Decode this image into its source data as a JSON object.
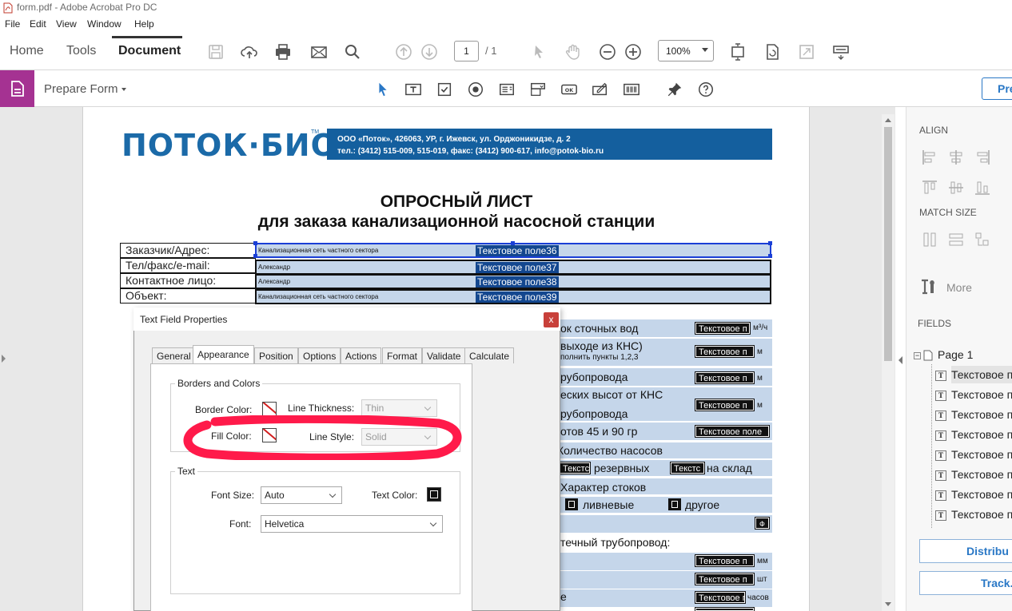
{
  "window": {
    "title": "form.pdf - Adobe Acrobat Pro DC"
  },
  "menu": [
    "File",
    "Edit",
    "View",
    "Window",
    "Help"
  ],
  "app_tabs": [
    "Home",
    "Tools",
    "Document"
  ],
  "toolbar": {
    "page_current": "1",
    "page_total": "/ 1",
    "zoom": "100%"
  },
  "prepare": {
    "label": "Prepare Form",
    "button": "Pre"
  },
  "colors": {
    "accent_purple": "#a53292",
    "brand_blue": "#145f9e",
    "field_fill": "#c5d6ea",
    "scribble_red": "#ff1a4a"
  },
  "right_panel": {
    "align": "ALIGN",
    "match_size": "MATCH SIZE",
    "more": "More",
    "fields": "FIELDS",
    "page": "Page 1",
    "field_items": [
      "Текстовое п",
      "Текстовое п",
      "Текстовое п",
      "Текстовое п",
      "Текстовое п",
      "Текстовое п",
      "Текстовое п",
      "Текстовое п"
    ],
    "distribute": "Distribu",
    "track": "Track."
  },
  "doc": {
    "logo": "ПОТОК·БИО",
    "logo_tm": "TM",
    "header_line1": "ООО «Поток», 426063, УР, г. Ижевск, ул. Орджоникидзе, д. 2",
    "header_line2": "тел.: (3412) 515-009, 515-019, факс: (3412) 900-617, info@potok-bio.ru",
    "title1": "ОПРОСНЫЙ ЛИСТ",
    "title2": "для заказа канализационной насосной станции",
    "rows": [
      {
        "label": "Заказчик/Адрес:",
        "value": "Канализационная сеть частного сектора",
        "field": "Текстовое поле36"
      },
      {
        "label": "Тел/факс/e-mail:",
        "value": "Александр",
        "field": "Текстовое поле37"
      },
      {
        "label": "Контактное лицо:",
        "value": "Александр",
        "field": "Текстовое поле38"
      },
      {
        "label": "Объект:",
        "value": "Канализационная сеть частного сектора",
        "field": "Текстовое поле39"
      }
    ],
    "right": {
      "r1": "ок сточных вод",
      "r1_unit": "м³/ч",
      "r2a": "выходе из КНС)",
      "r2b": "полнить пункты 1,2,3",
      "r2_unit": "м",
      "r3": "рубопровода",
      "r3_unit": "м",
      "r4a": "еских высот от КНС",
      "r4b": "рубопровода",
      "r4_unit": "м",
      "r5": "отов 45 и 90 гр",
      "r6": "Количество насосов",
      "r7a": "резервных",
      "r7b": "на склад",
      "r8": "Характер стоков",
      "r9a": "ливневые",
      "r9b": "другое",
      "r10": "Ф",
      "r11": "течный трубопровод:",
      "r12_unit": "мм",
      "r13_unit": "шт",
      "r14": "е",
      "r14_unit": "часов",
      "blk_field": "Текстовое п",
      "blk_long": "Текстовое поле",
      "blk_short": "Текстс"
    }
  },
  "dialog": {
    "title": "Text Field Properties",
    "close": "x",
    "tabs": [
      "General",
      "Appearance",
      "Position",
      "Options",
      "Actions",
      "Format",
      "Validate",
      "Calculate"
    ],
    "borders_group": "Borders and Colors",
    "border_color": "Border Color:",
    "line_thickness": "Line Thickness:",
    "line_thickness_value": "Thin",
    "fill_color": "Fill Color:",
    "line_style": "Line Style:",
    "line_style_value": "Solid",
    "text_group": "Text",
    "font_size": "Font Size:",
    "font_size_value": "Auto",
    "text_color": "Text Color:",
    "font": "Font:",
    "font_value": "Helvetica"
  }
}
